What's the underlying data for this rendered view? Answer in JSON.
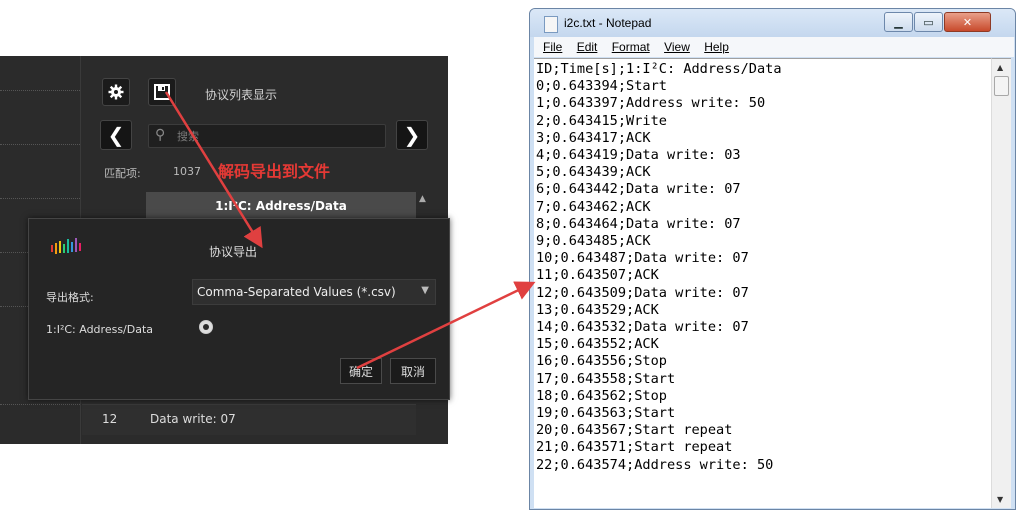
{
  "analyzer": {
    "toolbar": {
      "settings_icon": "gear-icon",
      "save_icon": "floppy-disk-icon",
      "protocol_list_label": "协议列表显示"
    },
    "search": {
      "placeholder": "搜索",
      "value": ""
    },
    "nav": {
      "prev_symbol": "❮",
      "next_symbol": "❯"
    },
    "matches": {
      "label": "匹配项:",
      "count": "1037"
    },
    "annotation": "解码导出到文件",
    "column_header": "1:I²C: Address/Data",
    "visible_row": {
      "index": "12",
      "text": "Data write: 07"
    },
    "export_dialog": {
      "title": "协议导出",
      "format_label": "导出格式:",
      "format_value": "Comma-Separated Values (*.csv)",
      "channel_label": "1:I²C: Address/Data",
      "ok_label": "确定",
      "cancel_label": "取消"
    }
  },
  "notepad": {
    "title": "i2c.txt - Notepad",
    "menu": [
      "File",
      "Edit",
      "Format",
      "View",
      "Help"
    ],
    "lines": [
      "ID;Time[s];1:I²C: Address/Data",
      "0;0.643394;Start",
      "1;0.643397;Address write: 50",
      "2;0.643415;Write",
      "3;0.643417;ACK",
      "4;0.643419;Data write: 03",
      "5;0.643439;ACK",
      "6;0.643442;Data write: 07",
      "7;0.643462;ACK",
      "8;0.643464;Data write: 07",
      "9;0.643485;ACK",
      "10;0.643487;Data write: 07",
      "11;0.643507;ACK",
      "12;0.643509;Data write: 07",
      "13;0.643529;ACK",
      "14;0.643532;Data write: 07",
      "15;0.643552;ACK",
      "16;0.643556;Stop",
      "17;0.643558;Start",
      "18;0.643562;Stop",
      "19;0.643563;Start",
      "20;0.643567;Start repeat",
      "21;0.643571;Start repeat",
      "22;0.643574;Address write: 50"
    ]
  },
  "colors": {
    "annotation_red": "#e53935",
    "arrow_red": "#e04040",
    "analyzer_bg": "#2b2b2b",
    "dialog_bg": "#252525"
  }
}
